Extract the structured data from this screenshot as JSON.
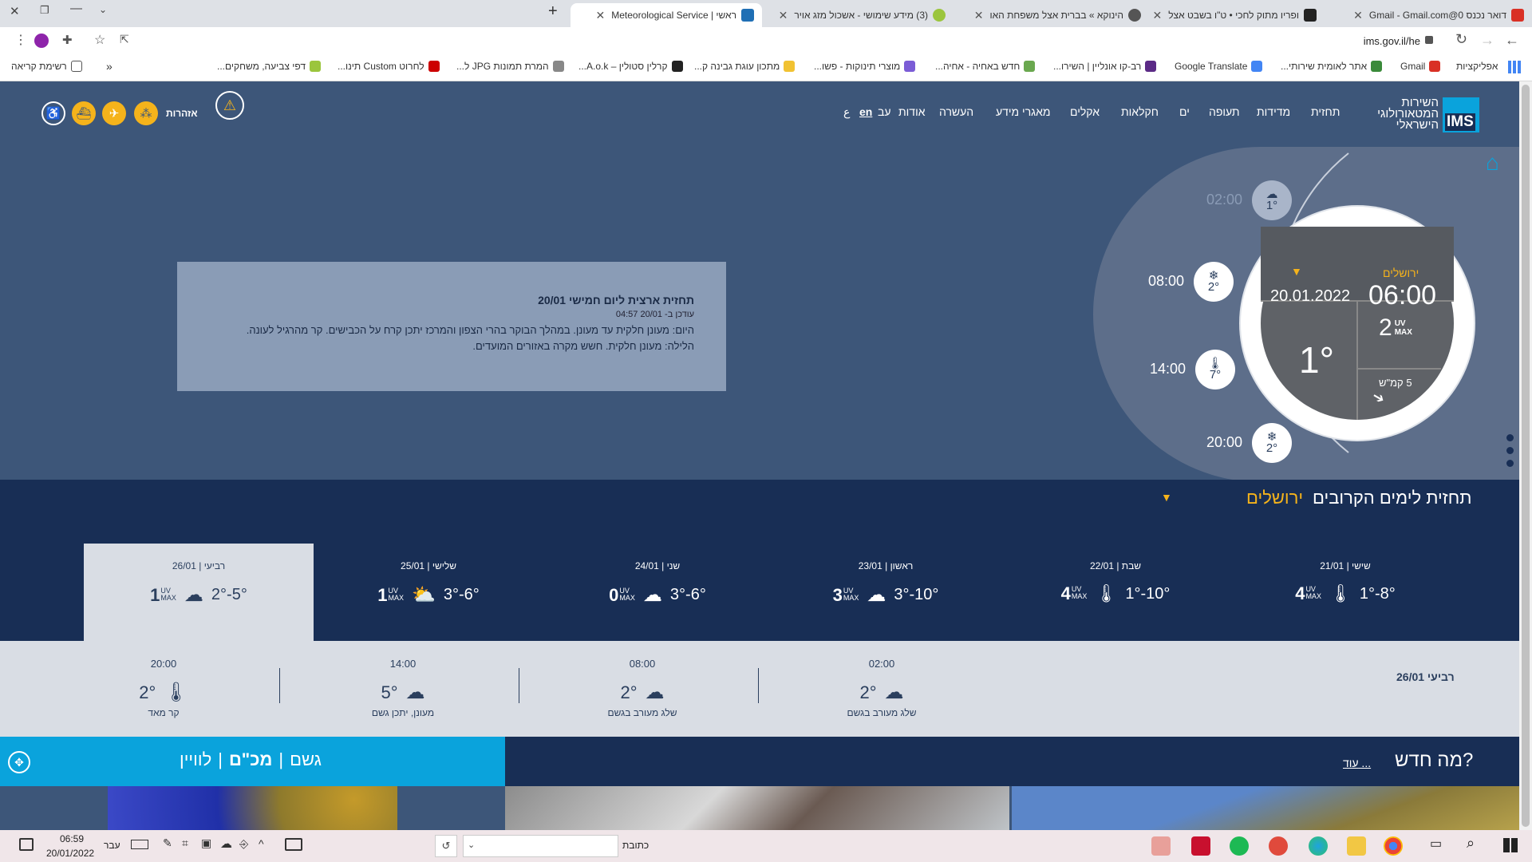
{
  "browser": {
    "tabs": [
      {
        "title": "דואר נכנס Gmail - Gmail.com@0",
        "fav": "#d93025"
      },
      {
        "title": "ופריו מתוק לחכי • ט\"ו בשבט אצל",
        "fav": "#222"
      },
      {
        "title": "הינוקא » בברית אצל משפחת האו",
        "fav": "#444"
      },
      {
        "title": "(3) מידע שימושי - אשכול מזג אויר",
        "fav": "#9bc53d"
      },
      {
        "title": "ראשי | Meteorological Service",
        "fav": "#1f6fb5"
      }
    ],
    "new_tab": "+",
    "url": "ims.gov.il/he",
    "bookmarks": [
      {
        "label": "אפליקציות",
        "fav": "#4285f4"
      },
      {
        "label": "Gmail",
        "fav": "#d93025"
      },
      {
        "label": "אתר לאומית שירותי...",
        "fav": "#3a8a3a"
      },
      {
        "label": "Google Translate",
        "fav": "#4285f4"
      },
      {
        "label": "רב-קו אונליין | השירו...",
        "fav": "#5b2a86"
      },
      {
        "label": "חדש באחיה - אחיה...",
        "fav": "#6aa84f"
      },
      {
        "label": "מוצרי תינוקות - פשו...",
        "fav": "#7b5cd6"
      },
      {
        "label": "מתכון עוגת גבינה ק...",
        "fav": "#f1c232"
      },
      {
        "label": "קרלין סטולין – A.o.k...",
        "fav": "#222"
      },
      {
        "label": "המרת תמונות JPG ל...",
        "fav": "#888"
      },
      {
        "label": "לחרוט Custom תינו...",
        "fav": "#cc0000"
      },
      {
        "label": "דפי צביעה, משחקים...",
        "fav": "#9bc53d"
      }
    ],
    "reading_list": "רשימת קריאה",
    "more": "»"
  },
  "site": {
    "logo_text": [
      "השירות",
      "המטאורולוגי",
      "הישראלי"
    ],
    "logo_badge": "IMS",
    "nav": [
      "תחזית",
      "מדידות",
      "תעופה",
      "ים",
      "חקלאות",
      "אקלים",
      "מאגרי מידע",
      "העשרה",
      "אודות",
      "עב",
      "en",
      "ع"
    ],
    "alerts_label": "אזהרות",
    "forecast": {
      "title": "תחזית ארצית ליום חמישי 20/01",
      "updated": "עודכן ב- 20/01 04:57",
      "today": "היום: מעונן חלקית עד מעונן. במהלך הבוקר בהרי הצפון והמרכז יתכן קרח על הכבישים. קר מהרגיל לעונה.",
      "tonight": "הלילה: מעונן חלקית. חשש מקרה באזורים המועדים."
    },
    "timeline": [
      {
        "time": "02:00",
        "temp": "1°",
        "icon": "snow-cloud-icon"
      },
      {
        "time": "08:00",
        "temp": "2°",
        "icon": "snowflake-icon"
      },
      {
        "time": "14:00",
        "temp": "7°",
        "icon": "thermometer-icon"
      },
      {
        "time": "20:00",
        "temp": "2°",
        "icon": "snowflake-icon"
      }
    ],
    "dial": {
      "city": "ירושלים",
      "date": "20.01.2022",
      "time": "06:00",
      "temp": "1°",
      "uv": "2",
      "uv_label": "UV",
      "uv_max": "MAX",
      "wind": "5 קמ\"ש"
    },
    "next_days": {
      "title": "תחזית לימים הקרובים",
      "city": "ירושלים"
    },
    "days": [
      {
        "name": "שישי",
        "date": "21/01",
        "uv": "4",
        "temp": "1°-8°",
        "icon": "thermometer-icon"
      },
      {
        "name": "שבת",
        "date": "22/01",
        "uv": "4",
        "temp": "1°-10°",
        "icon": "thermometer-icon"
      },
      {
        "name": "ראשון",
        "date": "23/01",
        "uv": "3",
        "temp": "3°-10°",
        "icon": "cloud-icon"
      },
      {
        "name": "שני",
        "date": "24/01",
        "uv": "0",
        "temp": "3°-6°",
        "icon": "snow-cloud-icon"
      },
      {
        "name": "שלישי",
        "date": "25/01",
        "uv": "1",
        "temp": "3°-6°",
        "icon": "sun-cloud-icon"
      },
      {
        "name": "רביעי",
        "date": "26/01",
        "uv": "1",
        "temp": "2°-5°",
        "icon": "cloud-icon"
      }
    ],
    "hourly_day_label": "רביעי 26/01",
    "hourly": [
      {
        "time": "02:00",
        "temp": "2°",
        "desc": "שלג מעורב בגשם",
        "icon": "snow-cloud-icon"
      },
      {
        "time": "08:00",
        "temp": "2°",
        "desc": "שלג מעורב בגשם",
        "icon": "snow-cloud-icon"
      },
      {
        "time": "14:00",
        "temp": "5°",
        "desc": "מעונן, יתכן גשם",
        "icon": "cloud-icon"
      },
      {
        "time": "20:00",
        "temp": "2°",
        "desc": "קר מאד",
        "icon": "thermometer-icon"
      }
    ],
    "rain_tabs": [
      "גשם",
      "מכ\"ם",
      "לוויין"
    ],
    "news_title": "מה חדש?",
    "news_more": "עוד ..."
  },
  "taskbar": {
    "time": "06:59",
    "date": "20/01/2022",
    "lang": "עבר",
    "address_label": "כתובת"
  },
  "colors": {
    "accent": "#f5b31b",
    "navy": "#182e55",
    "hero": "#3d5679",
    "rain": "#0aa3dc"
  }
}
